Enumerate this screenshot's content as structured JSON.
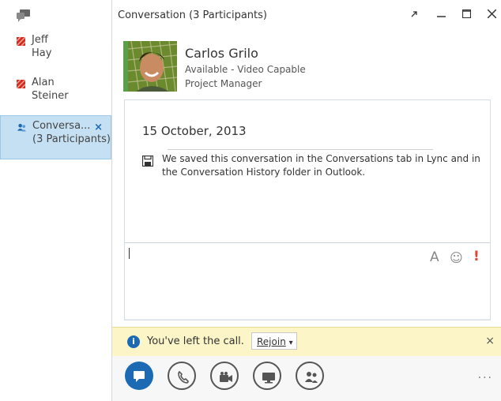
{
  "window": {
    "title": "Conversation (3 Participants)"
  },
  "sidebar": {
    "items": [
      {
        "first": "Jeff",
        "last": "Hay",
        "status": "busy"
      },
      {
        "first": "Alan",
        "last": "Steiner",
        "status": "busy"
      },
      {
        "first": "Conversa...",
        "last": "(3 Participants)",
        "status": "group",
        "close_label": "×"
      }
    ]
  },
  "contact": {
    "name": "Carlos Grilo",
    "status": "Available - Video Capable",
    "role": "Project Manager"
  },
  "history": {
    "date": "15 October, 2013",
    "saved_message": "We saved this conversation in the Conversations tab in Lync and in the Conversation History folder in Outlook."
  },
  "compose": {
    "font_label": "A",
    "emoji_label": "☺",
    "importance_label": "!"
  },
  "notification": {
    "text": "You've left the call.",
    "rejoin_label": "Rejoin",
    "dropdown_arrow": "▾",
    "close_label": "×"
  },
  "toolbar": {
    "more_label": "..."
  },
  "colors": {
    "accent": "#1b6ab3",
    "busy": "#d52b1e",
    "notify_bg": "#fbf5c8",
    "active_item_bg": "#c5e0f3"
  }
}
